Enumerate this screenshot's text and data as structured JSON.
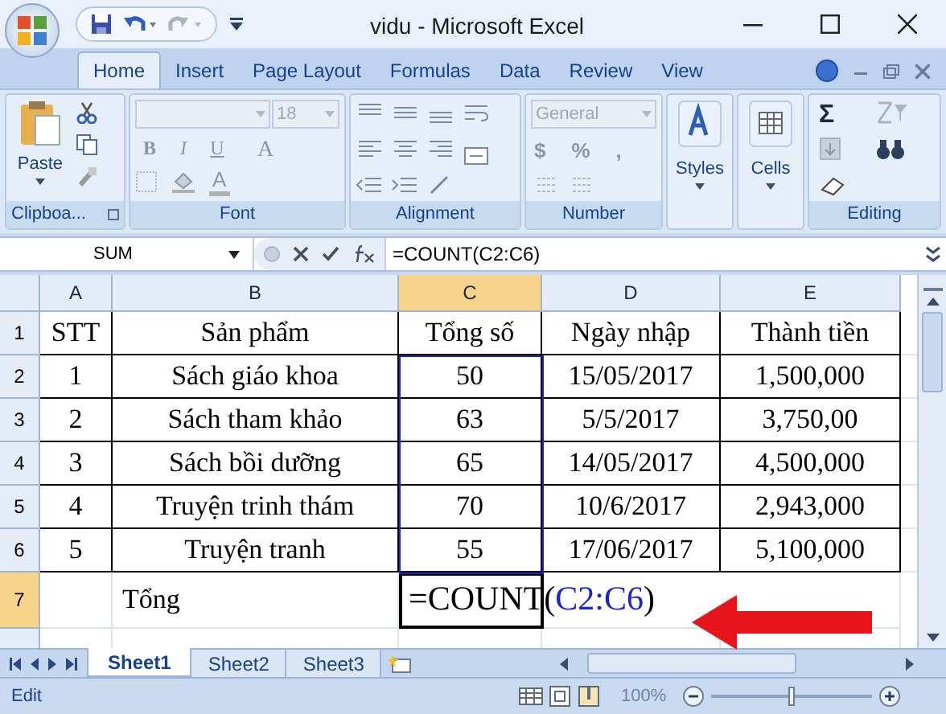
{
  "window": {
    "title": "vidu - Microsoft Excel"
  },
  "tabs": [
    {
      "label": "Home",
      "selected": true
    },
    {
      "label": "Insert",
      "selected": false
    },
    {
      "label": "Page Layout",
      "selected": false
    },
    {
      "label": "Formulas",
      "selected": false
    },
    {
      "label": "Data",
      "selected": false
    },
    {
      "label": "Review",
      "selected": false
    },
    {
      "label": "View",
      "selected": false
    }
  ],
  "ribbon": {
    "clipboard": {
      "paste": "Paste",
      "label": "Clipboa..."
    },
    "font": {
      "size": "18",
      "bold": "B",
      "italic": "I",
      "underline": "U",
      "grow": "A",
      "font_color": "A",
      "label": "Font"
    },
    "alignment": {
      "label": "Alignment"
    },
    "number": {
      "format": "General",
      "currency": "$",
      "percent": "%",
      "comma": ",",
      "label": "Number"
    },
    "styles": {
      "button": "Styles"
    },
    "cells": {
      "button": "Cells"
    },
    "editing": {
      "sum": "Σ",
      "label": "Editing"
    }
  },
  "formula_bar": {
    "name_box": "SUM",
    "formula": "=COUNT(C2:C6)"
  },
  "columns": [
    {
      "label": "A",
      "selected": false
    },
    {
      "label": "B",
      "selected": false
    },
    {
      "label": "C",
      "selected": true
    },
    {
      "label": "D",
      "selected": false
    },
    {
      "label": "E",
      "selected": false
    }
  ],
  "rows": [
    {
      "number": "1",
      "selected": false,
      "cells": [
        "STT",
        "Sản phẩm",
        "Tổng số",
        "Ngày nhập",
        "Thành tiền"
      ]
    },
    {
      "number": "2",
      "selected": false,
      "cells": [
        "1",
        "Sách giáo khoa",
        "50",
        "15/05/2017",
        "1,500,000"
      ]
    },
    {
      "number": "3",
      "selected": false,
      "cells": [
        "2",
        "Sách tham khảo",
        "63",
        "5/5/2017",
        "3,750,00"
      ]
    },
    {
      "number": "4",
      "selected": false,
      "cells": [
        "3",
        "Sách bồi dưỡng",
        "65",
        "14/05/2017",
        "4,500,000"
      ]
    },
    {
      "number": "5",
      "selected": false,
      "cells": [
        "4",
        "Truyện trinh thám",
        "70",
        "10/6/2017",
        "2,943,000"
      ]
    },
    {
      "number": "6",
      "selected": false,
      "cells": [
        "5",
        "Truyện tranh",
        "55",
        "17/06/2017",
        "5,100,000"
      ]
    },
    {
      "number": "7",
      "selected": true,
      "label": "Tổng",
      "formula": {
        "head": "=COUNT(",
        "range": "C2:C6",
        "tail": ")"
      }
    }
  ],
  "sheets": [
    {
      "label": "Sheet1",
      "selected": true
    },
    {
      "label": "Sheet2",
      "selected": false
    },
    {
      "label": "Sheet3",
      "selected": false
    }
  ],
  "status_bar": {
    "mode": "Edit",
    "zoom": "100%",
    "level": 0.5
  }
}
